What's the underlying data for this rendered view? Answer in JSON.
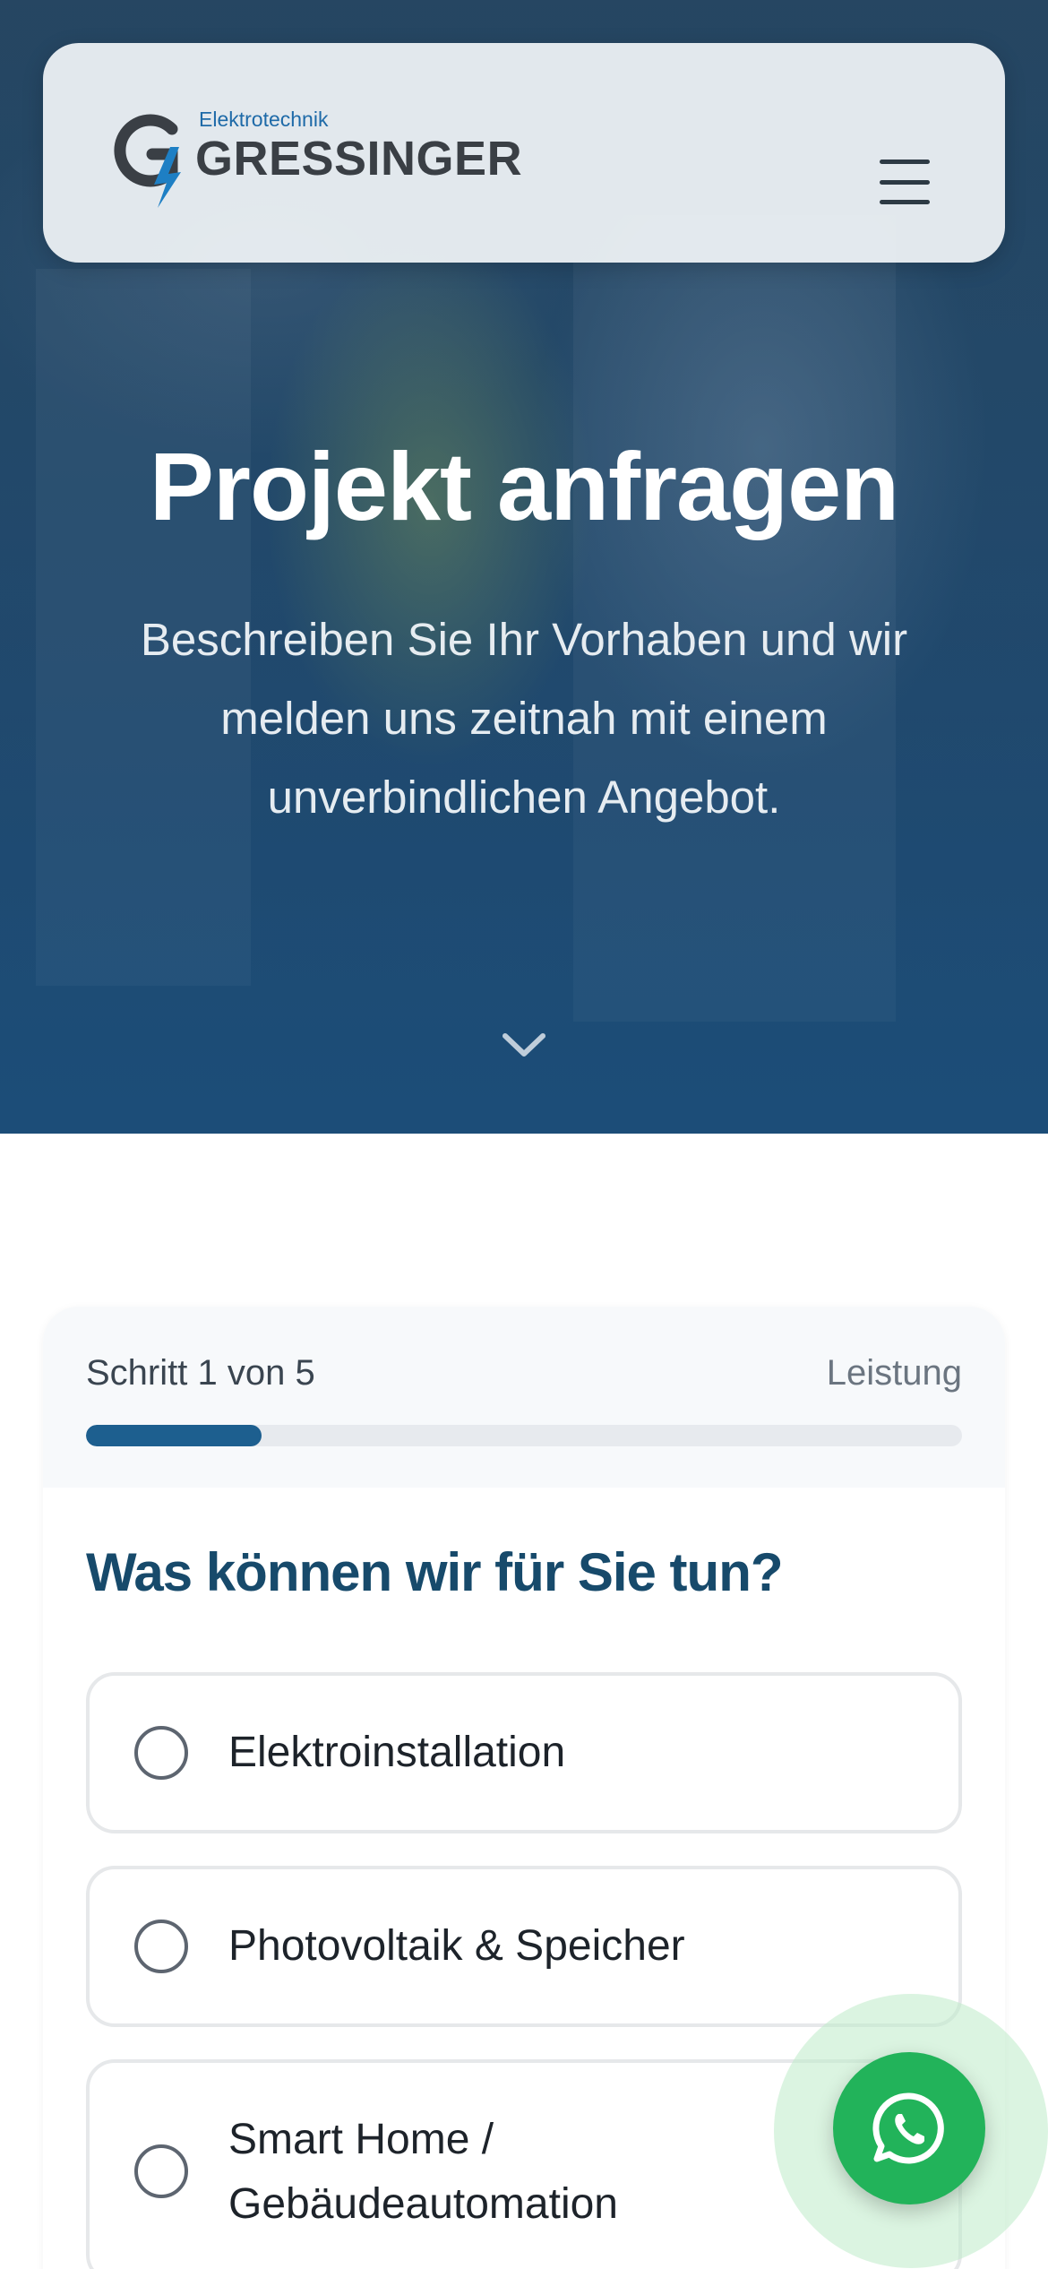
{
  "header": {
    "logo_subtitle": "Elektrotechnik",
    "logo_name": "GRESSINGER",
    "menu_icon": "hamburger-menu-icon"
  },
  "hero": {
    "title": "Projekt anfragen",
    "subtitle_lines": [
      "Beschreiben Sie Ihr Vorhaben und wir",
      "melden uns zeitnah mit einem",
      "unverbindlichen Angebot."
    ],
    "scroll_icon": "chevron-down-icon"
  },
  "form": {
    "step_label": "Schritt 1 von 5",
    "step_name": "Leistung",
    "progress": 0.2,
    "question": "Was können wir für Sie tun?",
    "options": [
      {
        "label": "Elektroinstallation"
      },
      {
        "label": "Photovoltaik & Speicher"
      },
      {
        "label_lines": [
          "Smart Home /",
          "Gebäudeautomation"
        ]
      }
    ]
  },
  "floating": {
    "whatsapp_icon": "whatsapp-icon"
  },
  "colors": {
    "brand_blue": "#174a6b",
    "progress_fill": "#1d5f8f",
    "whatsapp_green": "#22b35a",
    "logo_blue": "#1e6aa8"
  }
}
